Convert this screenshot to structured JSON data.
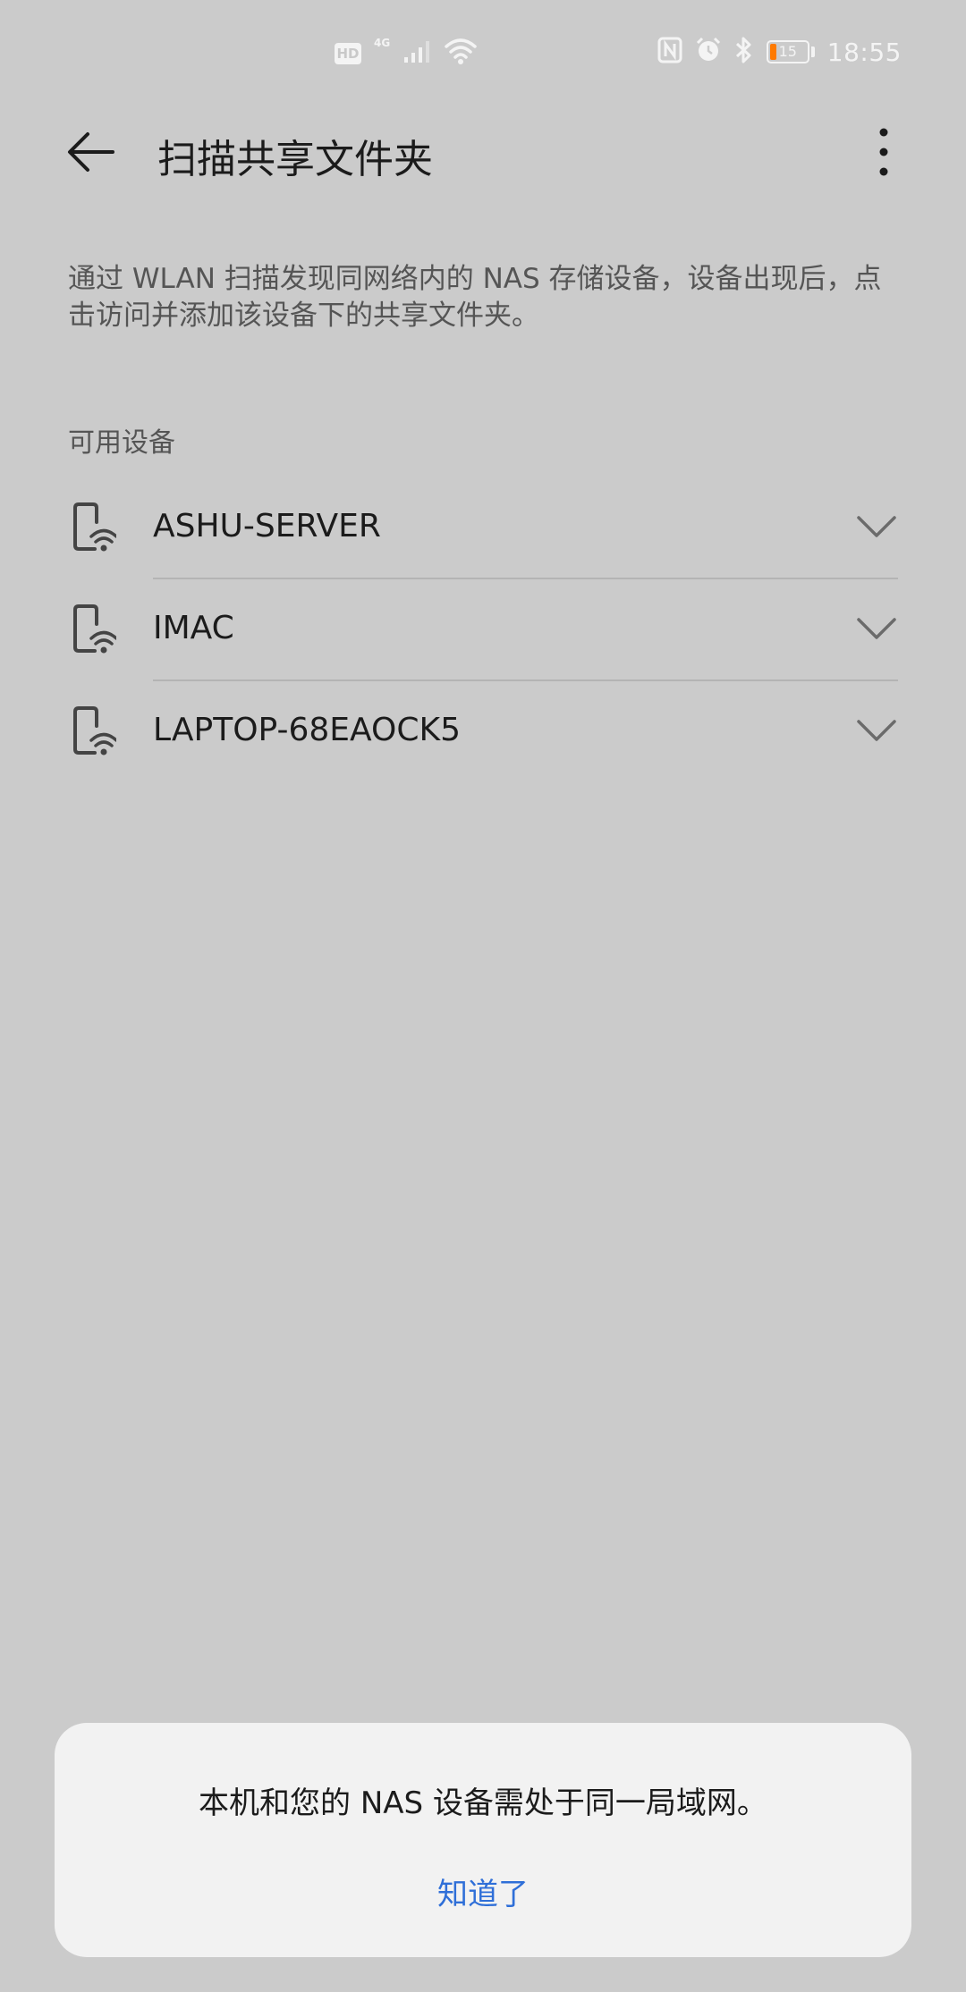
{
  "status_bar": {
    "hd_badge": "HD",
    "network_type": "4G",
    "battery_level": "15",
    "time": "18:55",
    "icons": [
      "hd-icon",
      "signal-icon",
      "wifi-icon",
      "nfc-icon",
      "alarm-icon",
      "bluetooth-icon",
      "battery-icon"
    ]
  },
  "app_bar": {
    "title": "扫描共享文件夹",
    "back_icon": "back-arrow-icon",
    "more_icon": "more-vertical-icon"
  },
  "description": "通过 WLAN 扫描发现同网络内的 NAS 存储设备，设备出现后，点击访问并添加该设备下的共享文件夹。",
  "section_header": "可用设备",
  "devices": [
    {
      "name": "ASHU-SERVER",
      "icon": "network-device-icon",
      "expand_icon": "chevron-down-icon"
    },
    {
      "name": "IMAC",
      "icon": "network-device-icon",
      "expand_icon": "chevron-down-icon"
    },
    {
      "name": "LAPTOP-68EAOCK5",
      "icon": "network-device-icon",
      "expand_icon": "chevron-down-icon"
    }
  ],
  "dialog": {
    "message": "本机和您的 NAS 设备需处于同一局域网。",
    "button_label": "知道了"
  },
  "colors": {
    "background": "#cbcbcb",
    "dialog_background": "#f2f2f2",
    "accent": "#2f6fd8",
    "battery_low": "#ff7a00"
  }
}
